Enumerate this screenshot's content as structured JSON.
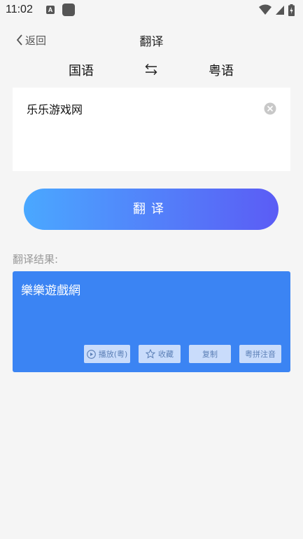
{
  "status_bar": {
    "time": "11:02",
    "notification_letter": "A"
  },
  "nav": {
    "back_label": "返回",
    "title": "翻译"
  },
  "languages": {
    "source": "国语",
    "swap_icon": "swap-arrows-icon",
    "target": "粤语"
  },
  "input": {
    "value": "乐乐游戏网"
  },
  "translate_button": {
    "label": "翻译"
  },
  "result": {
    "label": "翻译结果:",
    "text": "樂樂遊戲網",
    "actions": {
      "play": "播放(粤)",
      "favorite": "收藏",
      "copy": "复制",
      "pinyin": "粤拼注音"
    }
  },
  "colors": {
    "accent": "#3b84f3",
    "gradient_start": "#4aa8ff",
    "gradient_end": "#5b5cf5",
    "background": "#f5f5f5"
  }
}
